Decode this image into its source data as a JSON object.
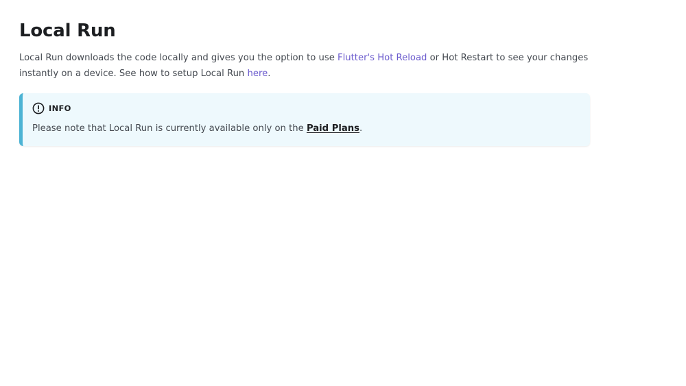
{
  "page": {
    "title": "Local Run",
    "intro": {
      "part1": "Local Run downloads the code locally and gives you the option to use ",
      "link_hot_reload": "Flutter's Hot Reload",
      "part2": " or Hot Restart to see your changes instantly on a device. See how to setup Local Run ",
      "link_here": "here",
      "part3": "."
    }
  },
  "admonition": {
    "icon": "info-circle-icon",
    "label": "INFO",
    "text_before": "Please note that Local Run is currently available only on the ",
    "link_paid_plans": "Paid Plans",
    "text_after": "."
  },
  "colors": {
    "link": "#6a5acd",
    "admonition_bg": "#eef9fd",
    "admonition_border": "#4cb3d4"
  }
}
